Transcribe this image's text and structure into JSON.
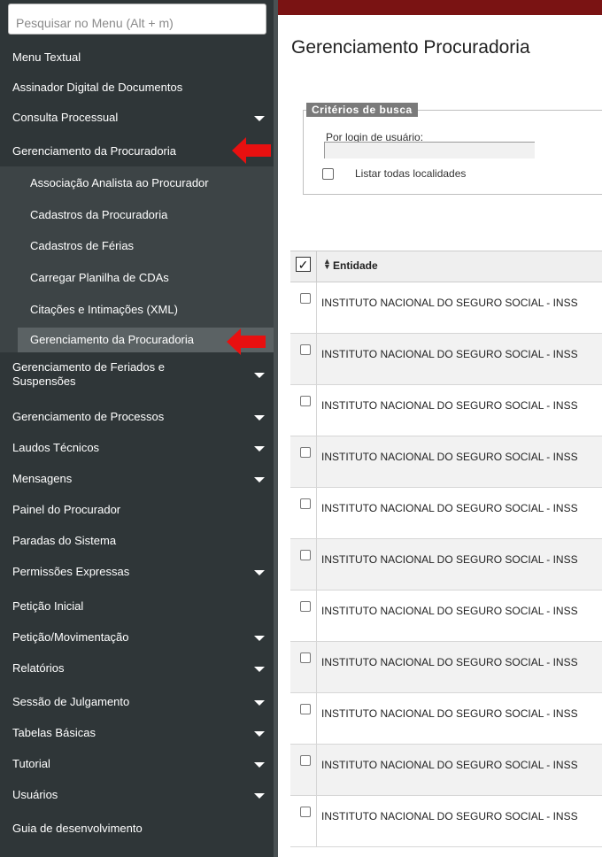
{
  "sidebar": {
    "search_placeholder": "Pesquisar no Menu (Alt + m)",
    "items": [
      {
        "label": "Menu Textual"
      },
      {
        "label": "Assinador Digital de Documentos"
      },
      {
        "label": "Consulta Processual"
      },
      {
        "label": "Gerenciamento da Procuradoria"
      },
      {
        "label": "Associação Analista ao Procurador"
      },
      {
        "label": "Cadastros da Procuradoria"
      },
      {
        "label": "Cadastros de Férias"
      },
      {
        "label": "Carregar Planilha de CDAs"
      },
      {
        "label": "Citações e Intimações (XML)"
      },
      {
        "label": "Gerenciamento da Procuradoria"
      },
      {
        "label": "Gerenciamento de Feriados e Suspensões"
      },
      {
        "label": "Gerenciamento de Processos"
      },
      {
        "label": "Laudos Técnicos"
      },
      {
        "label": "Mensagens"
      },
      {
        "label": "Painel do Procurador"
      },
      {
        "label": "Paradas do Sistema"
      },
      {
        "label": "Permissões Expressas"
      },
      {
        "label": "Petição Inicial"
      },
      {
        "label": "Petição/Movimentação"
      },
      {
        "label": "Relatórios"
      },
      {
        "label": "Sessão de Julgamento"
      },
      {
        "label": "Tabelas Básicas"
      },
      {
        "label": "Tutorial"
      },
      {
        "label": "Usuários"
      },
      {
        "label": "Guia de desenvolvimento"
      }
    ]
  },
  "main": {
    "title": "Gerenciamento Procuradoria",
    "search_criteria": {
      "legend": "Critérios de busca",
      "login_label": "Por login de usuário:",
      "login_value": "",
      "list_all_label": "Listar todas localidades"
    },
    "table": {
      "column_header": "Entidade",
      "rows": [
        "INSTITUTO NACIONAL DO SEGURO SOCIAL - INSS",
        "INSTITUTO NACIONAL DO SEGURO SOCIAL - INSS",
        "INSTITUTO NACIONAL DO SEGURO SOCIAL - INSS",
        "INSTITUTO NACIONAL DO SEGURO SOCIAL - INSS",
        "INSTITUTO NACIONAL DO SEGURO SOCIAL - INSS",
        "INSTITUTO NACIONAL DO SEGURO SOCIAL - INSS",
        "INSTITUTO NACIONAL DO SEGURO SOCIAL - INSS",
        "INSTITUTO NACIONAL DO SEGURO SOCIAL - INSS",
        "INSTITUTO NACIONAL DO SEGURO SOCIAL - INSS",
        "INSTITUTO NACIONAL DO SEGURO SOCIAL - INSS",
        "INSTITUTO NACIONAL DO SEGURO SOCIAL - INSS"
      ]
    }
  },
  "colors": {
    "sidebar_bg": "#2f3638",
    "submenu_bg": "#3d4446",
    "submenu_active_bg": "#5b6264",
    "topbar": "#7a1313",
    "annotation_arrow": "#e81010"
  }
}
